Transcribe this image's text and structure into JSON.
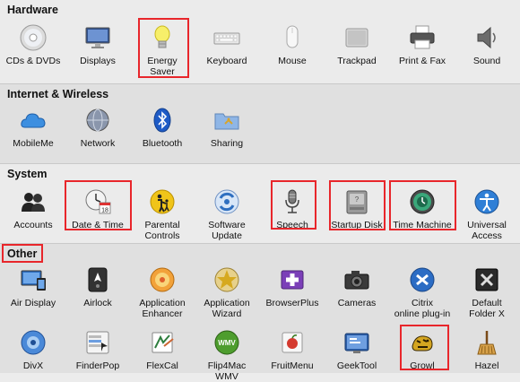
{
  "sections": {
    "hardware": {
      "title": "Hardware",
      "items": [
        {
          "line1": "CDs & DVDs",
          "line2": ""
        },
        {
          "line1": "Displays",
          "line2": ""
        },
        {
          "line1": "Energy",
          "line2": "Saver"
        },
        {
          "line1": "Keyboard",
          "line2": ""
        },
        {
          "line1": "Mouse",
          "line2": ""
        },
        {
          "line1": "Trackpad",
          "line2": ""
        },
        {
          "line1": "Print & Fax",
          "line2": ""
        },
        {
          "line1": "Sound",
          "line2": ""
        }
      ]
    },
    "internet": {
      "title": "Internet & Wireless",
      "items": [
        {
          "line1": "MobileMe",
          "line2": ""
        },
        {
          "line1": "Network",
          "line2": ""
        },
        {
          "line1": "Bluetooth",
          "line2": ""
        },
        {
          "line1": "Sharing",
          "line2": ""
        }
      ]
    },
    "system": {
      "title": "System",
      "items": [
        {
          "line1": "Accounts",
          "line2": ""
        },
        {
          "line1": "Date & Time",
          "line2": ""
        },
        {
          "line1": "Parental",
          "line2": "Controls"
        },
        {
          "line1": "Software",
          "line2": "Update"
        },
        {
          "line1": "Speech",
          "line2": ""
        },
        {
          "line1": "Startup Disk",
          "line2": ""
        },
        {
          "line1": "Time Machine",
          "line2": ""
        },
        {
          "line1": "Universal",
          "line2": "Access"
        }
      ]
    },
    "other": {
      "title": "Other",
      "row1": [
        {
          "line1": "Air Display",
          "line2": ""
        },
        {
          "line1": "Airlock",
          "line2": ""
        },
        {
          "line1": "Application",
          "line2": "Enhancer"
        },
        {
          "line1": "Application",
          "line2": "Wizard"
        },
        {
          "line1": "BrowserPlus",
          "line2": ""
        },
        {
          "line1": "Cameras",
          "line2": ""
        },
        {
          "line1": "Citrix",
          "line2": "online plug-in"
        },
        {
          "line1": "Default",
          "line2": "Folder X"
        }
      ],
      "row2": [
        {
          "line1": "DivX",
          "line2": ""
        },
        {
          "line1": "FinderPop",
          "line2": ""
        },
        {
          "line1": "FlexCal",
          "line2": ""
        },
        {
          "line1": "Flip4Mac",
          "line2": "WMV"
        },
        {
          "line1": "FruitMenu",
          "line2": ""
        },
        {
          "line1": "GeekTool",
          "line2": ""
        },
        {
          "line1": "Growl",
          "line2": ""
        },
        {
          "line1": "Hazel",
          "line2": ""
        }
      ]
    }
  },
  "icon_text": {
    "date_cal": "18",
    "wmv": "WMV"
  },
  "highlight_color": "#e8262b"
}
